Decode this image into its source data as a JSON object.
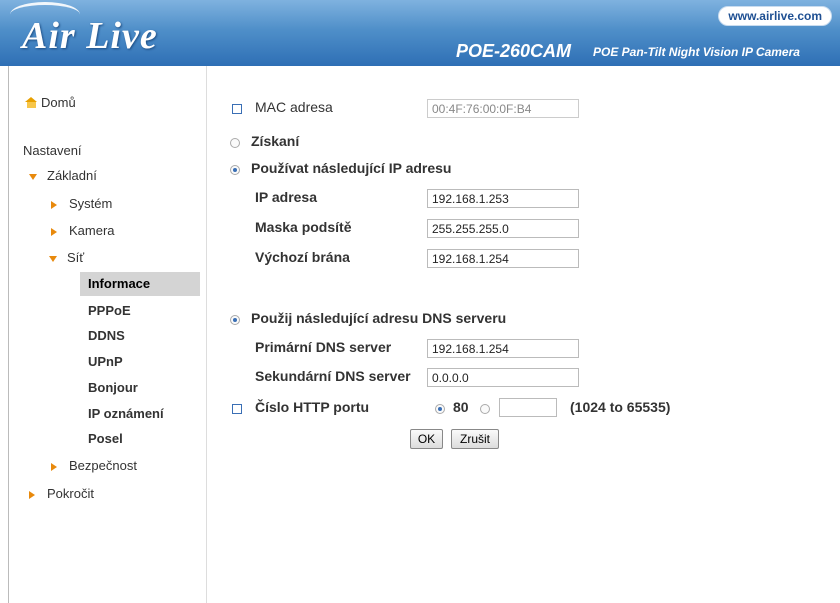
{
  "header": {
    "logo": "Air Live",
    "url": "www.airlive.com",
    "model": "POE-260CAM",
    "tagline": "POE Pan-Tilt Night Vision IP Camera"
  },
  "sidebar": {
    "home": "Domů",
    "settings": "Nastavení",
    "basic": "Základní",
    "system": "Systém",
    "camera": "Kamera",
    "network": "Síť",
    "network_items": [
      "Informace",
      "PPPoE",
      "DDNS",
      "UPnP",
      "Bonjour",
      "IP oznámení",
      "Posel"
    ],
    "security": "Bezpečnost",
    "advanced": "Pokročit"
  },
  "form": {
    "mac_label": "MAC adresa",
    "mac_value": "00:4F:76:00:0F:B4",
    "obtain_label": "Získaní",
    "use_ip_label": "Používat následující IP adresu",
    "ip_label": "IP adresa",
    "ip_value": "192.168.1.253",
    "mask_label": "Maska podsítě",
    "mask_value": "255.255.255.0",
    "gateway_label": "Výchozí brána",
    "gateway_value": "192.168.1.254",
    "dns_label": "Použij následující adresu DNS serveru",
    "primary_dns_label": "Primární DNS server",
    "primary_dns_value": "192.168.1.254",
    "secondary_dns_label": "Sekundární DNS server",
    "secondary_dns_value": "0.0.0.0",
    "http_label": "Číslo HTTP portu",
    "http_default": "80",
    "http_custom_value": "",
    "http_range": "(1024 to 65535)",
    "ok": "OK",
    "cancel": "Zrušit"
  },
  "colors": {
    "header_blue": "#2e6fb5",
    "accent_orange": "#e8890c",
    "selected_bg": "#d4d4d4"
  }
}
